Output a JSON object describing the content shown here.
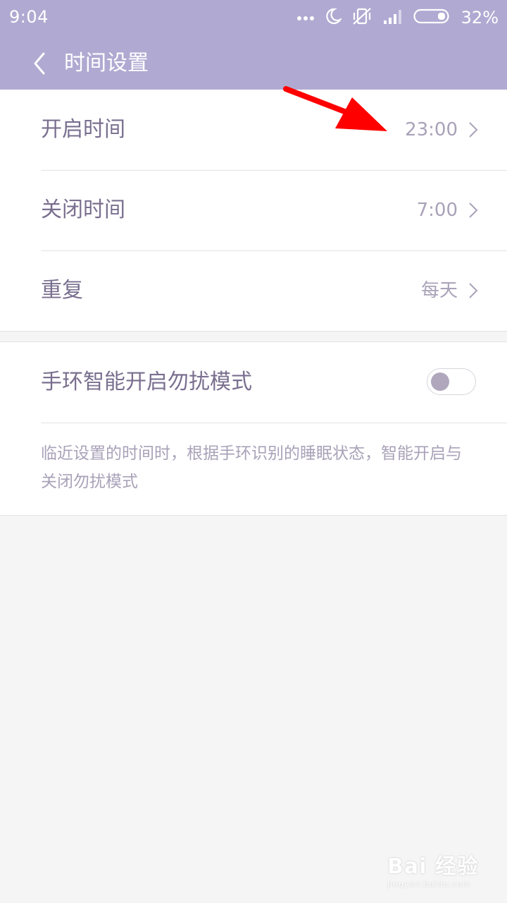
{
  "status_bar": {
    "time": "9:04",
    "battery_percent": "32%",
    "battery_level": 0.32,
    "icons": [
      "more-dots-icon",
      "moon-icon",
      "vibrate-off-icon",
      "signal-icon",
      "battery-icon"
    ]
  },
  "header": {
    "title": "时间设置",
    "background": "#b0aad2"
  },
  "settings": {
    "start_time": {
      "label": "开启时间",
      "value": "23:00"
    },
    "end_time": {
      "label": "关闭时间",
      "value": "7:00"
    },
    "repeat": {
      "label": "重复",
      "value": "每天"
    }
  },
  "smart_mode": {
    "label": "手环智能开启勿扰模式",
    "enabled": false,
    "description": "临近设置的时间时，根据手环识别的睡眠状态，智能开启与关闭勿扰模式"
  },
  "annotation": {
    "arrow_color": "#ff0000"
  },
  "watermark": {
    "main": "Bai 经验",
    "sub": "jingyan.baidu.com"
  }
}
